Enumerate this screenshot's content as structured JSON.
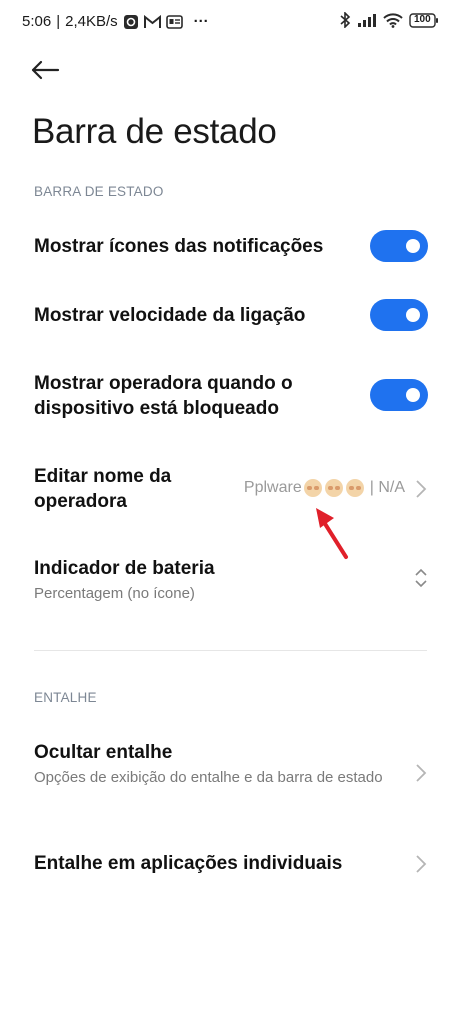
{
  "status_bar": {
    "time": "5:06",
    "separator": "|",
    "net_speed": "2,4KB/s",
    "more": "···",
    "battery": "100"
  },
  "title": "Barra de estado",
  "sections": {
    "status_bar_header": "BARRA DE ESTADO",
    "notch_header": "ENTALHE"
  },
  "rows": {
    "show_notification_icons": {
      "label": "Mostrar ícones das notificações",
      "enabled": true
    },
    "show_connection_speed": {
      "label": "Mostrar velocidade da ligação",
      "enabled": true
    },
    "show_carrier_locked": {
      "label": "Mostrar operadora quando o dispositivo está bloqueado",
      "enabled": true
    },
    "edit_carrier_name": {
      "label": "Editar nome da operadora",
      "value_prefix": "Pplware",
      "value_suffix": "| N/A"
    },
    "battery_indicator": {
      "label": "Indicador de bateria",
      "subtitle": "Percentagem (no ícone)"
    },
    "hide_notch": {
      "label": "Ocultar entalhe",
      "subtitle": "Opções de exibição do entalhe e da barra de estado"
    },
    "notch_per_app": {
      "label": "Entalhe em aplicações individuais"
    }
  },
  "colors": {
    "accent": "#1f72ef",
    "annotation_arrow": "#e0202a"
  },
  "icons": {
    "back": "arrow-left-icon",
    "chevron": "chevron-right-icon",
    "updown": "chevron-up-down-icon"
  }
}
